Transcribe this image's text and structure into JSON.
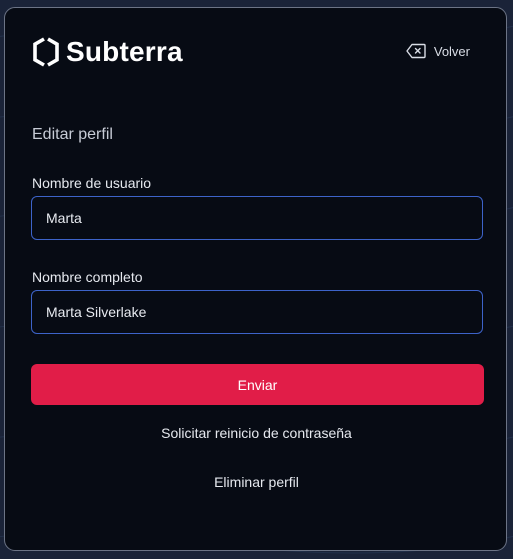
{
  "brand": {
    "name": "Subterra",
    "logo_icon": "hexagon-logo-icon"
  },
  "header": {
    "back_label": "Volver",
    "back_icon": "backspace-icon"
  },
  "form": {
    "title": "Editar perfil",
    "username": {
      "label": "Nombre de usuario",
      "value": "Marta"
    },
    "full_name": {
      "label": "Nombre completo",
      "value": "Marta Silverlake"
    },
    "submit_label": "Enviar",
    "reset_password_label": "Solicitar reinicio de contraseña",
    "delete_profile_label": "Eliminar perfil"
  },
  "colors": {
    "accent": "#e11d48",
    "input_border": "#3d63c9",
    "card_background": "#070b14",
    "page_background": "#1a2338"
  }
}
